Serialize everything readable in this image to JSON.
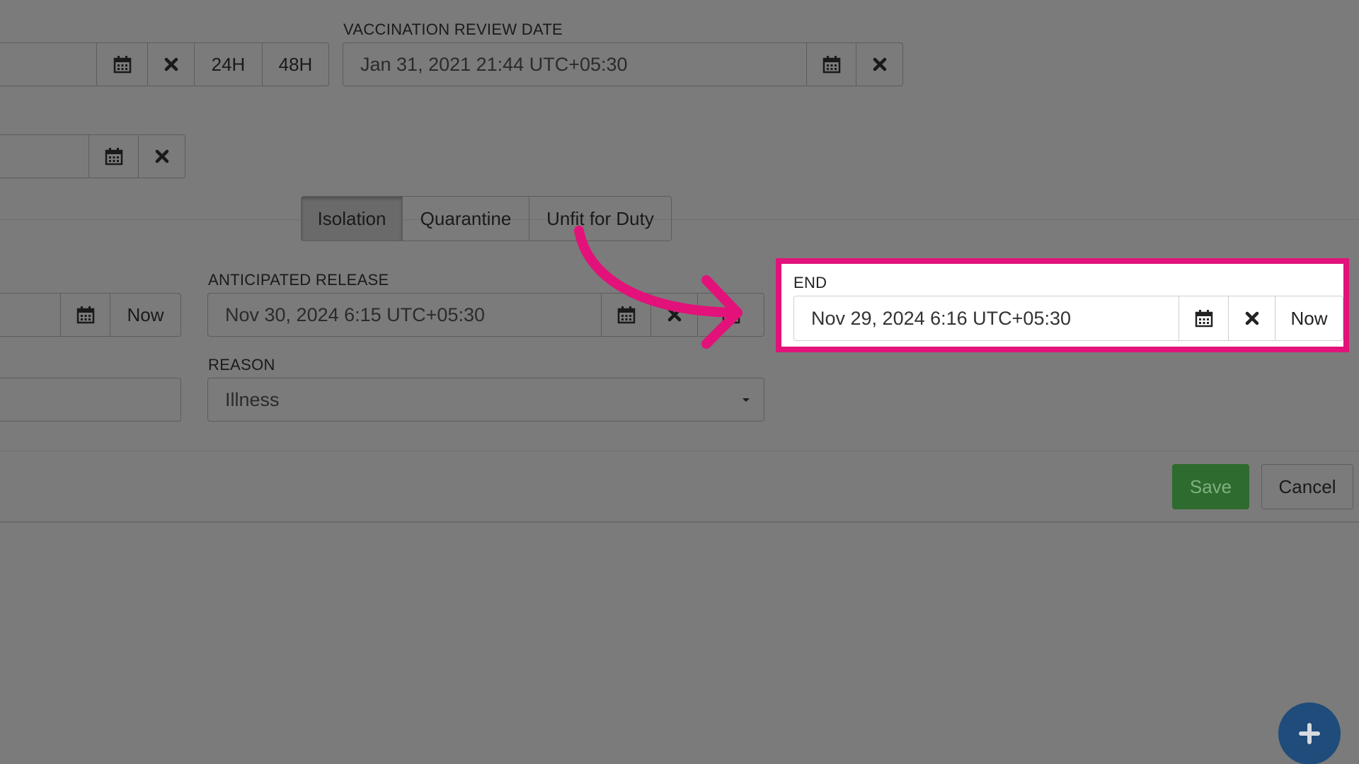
{
  "row1": {
    "left_group": {
      "value": "",
      "btn_24h": "24H",
      "btn_48h": "48H"
    },
    "vaccination_review": {
      "label": "VACCINATION REVIEW DATE",
      "value": "Jan 31, 2021 21:44 UTC+05:30"
    }
  },
  "row2": {
    "value": ""
  },
  "type_toggle": {
    "options": [
      "Isolation",
      "Quarantine",
      "Unfit for Duty"
    ],
    "selected": "Isolation"
  },
  "row3": {
    "left_group": {
      "value": "",
      "now_label": "Now"
    },
    "anticipated_release": {
      "label": "ANTICIPATED RELEASE",
      "value": "Nov 30, 2024 6:15 UTC+05:30"
    },
    "end": {
      "label": "END",
      "value": "Nov 29, 2024 6:16 UTC+05:30",
      "now_label": "Now"
    }
  },
  "reason": {
    "label": "REASON",
    "value": "Illness"
  },
  "footer": {
    "save_label": "Save",
    "cancel_label": "Cancel"
  },
  "colors": {
    "highlight": "#e2127a",
    "save": "#2e6b2e",
    "fab": "#1f4c7a"
  }
}
